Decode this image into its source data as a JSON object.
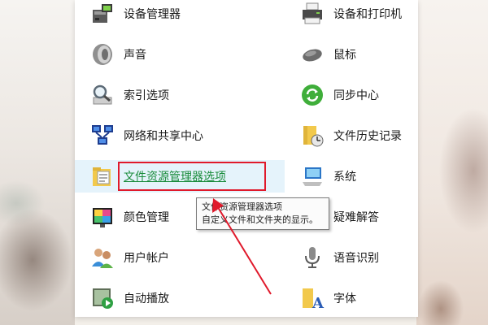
{
  "control_panel": {
    "left_items": [
      {
        "label": "设备管理器",
        "icon": "device-manager-icon"
      },
      {
        "label": "声音",
        "icon": "speaker-icon"
      },
      {
        "label": "索引选项",
        "icon": "magnifier-icon"
      },
      {
        "label": "网络和共享中心",
        "icon": "network-icon"
      },
      {
        "label": "文件资源管理器选项",
        "icon": "folder-options-icon"
      },
      {
        "label": "颜色管理",
        "icon": "color-management-icon"
      },
      {
        "label": "用户帐户",
        "icon": "users-icon"
      },
      {
        "label": "自动播放",
        "icon": "autoplay-icon"
      }
    ],
    "right_items": [
      {
        "label": "设备和打印机",
        "icon": "printer-icon"
      },
      {
        "label": "鼠标",
        "icon": "mouse-icon"
      },
      {
        "label": "同步中心",
        "icon": "sync-icon"
      },
      {
        "label": "文件历史记录",
        "icon": "file-history-icon"
      },
      {
        "label": "系统",
        "icon": "computer-icon"
      },
      {
        "label": "疑难解答",
        "icon": "troubleshooting-icon"
      },
      {
        "label": "语音识别",
        "icon": "microphone-icon"
      },
      {
        "label": "字体",
        "icon": "fonts-icon"
      }
    ]
  },
  "tooltip": {
    "title": "文件资源管理器选项",
    "description": "自定义文件和文件夹的显示。"
  },
  "colors": {
    "highlight_bg": "#e5f3fb",
    "link_green": "#1a8c3c",
    "annotation_red": "#e0192b"
  }
}
